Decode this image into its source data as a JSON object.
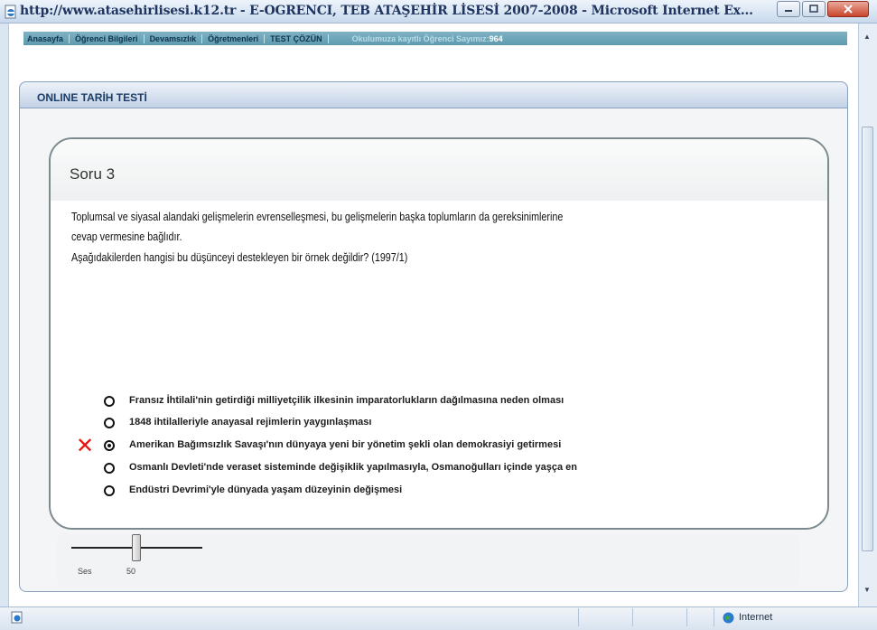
{
  "window": {
    "title": "http://www.atasehirlisesi.k12.tr - E-OGRENCI, TEB ATAŞEHİR LİSESİ 2007-2008 - Microsoft Internet Ex..."
  },
  "nav": {
    "items": [
      "Anasayfa",
      "Öğrenci Bilgileri",
      "Devamsızlık",
      "Öğretmenleri",
      "TEST ÇÖZÜN"
    ],
    "info_label": "Okulumuza kayıtlı Öğrenci Sayımız:",
    "student_count": "964"
  },
  "panel": {
    "title": "ONLINE TARİH TESTİ"
  },
  "question": {
    "title": "Soru 3",
    "lines": [
      "Toplumsal ve siyasal alandaki gelişmelerin evrenselleşmesi, bu gelişmelerin başka toplumların da gereksinimlerine",
      "cevap vermesine bağlıdır.",
      "Aşağıdakilerden hangisi bu düşünceyi destekleyen bir örnek değildir? (1997/1)"
    ]
  },
  "options": [
    {
      "label": "Fransız İhtilali'nin getirdiği milliyetçilik ilkesinin imparatorlukların dağılmasına neden olması",
      "selected": false
    },
    {
      "label": "1848 ihtilalleriyle anayasal rejimlerin yaygınlaşması",
      "selected": false
    },
    {
      "label": "Amerikan Bağımsızlık Savaşı'nın dünyaya yeni bir yönetim şekli olan demokrasiyi getirmesi",
      "selected": true
    },
    {
      "label": "Osmanlı Devleti'nde veraset sisteminde değişiklik yapılmasıyla, Osmanoğulları içinde yaşça en",
      "selected": false
    },
    {
      "label": "Endüstri Devrimi'yle dünyada yaşam düzeyinin değişmesi",
      "selected": false
    }
  ],
  "wrong_mark": "✕",
  "volume": {
    "label": "Ses",
    "value": "50",
    "level": 0.5
  },
  "status": {
    "zone": "Internet"
  },
  "colors": {
    "accent": "#1b3d66",
    "wrong": "#e8130c",
    "nav_bg": "#6fa6b9"
  }
}
